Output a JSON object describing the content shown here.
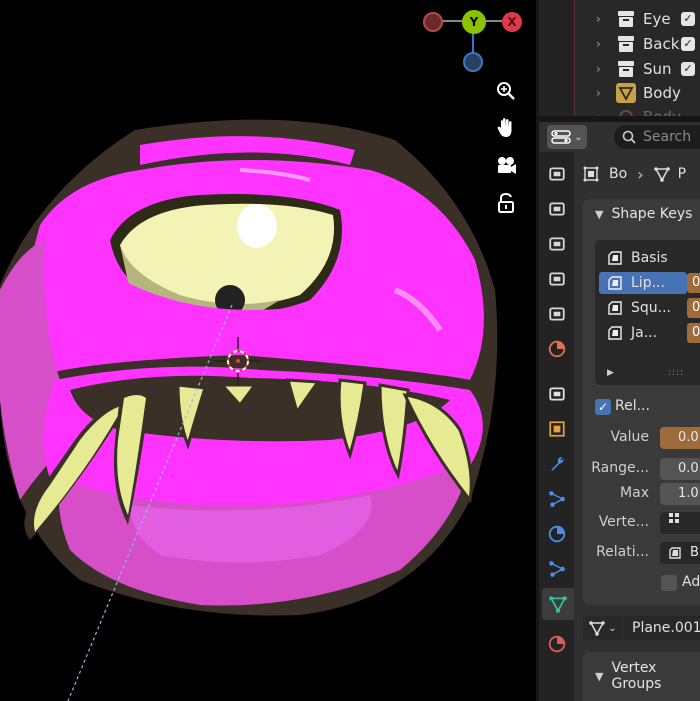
{
  "outliner": {
    "items": [
      {
        "label": "Eye",
        "checked": true,
        "icon": "collection-icon"
      },
      {
        "label": "Back",
        "checked": true,
        "icon": "collection-icon"
      },
      {
        "label": "Sun",
        "checked": true,
        "icon": "collection-icon"
      },
      {
        "label": "Body",
        "checked": false,
        "icon": "mesh-triangle-icon"
      },
      {
        "label": "Body",
        "checked": false,
        "icon": "object-icon"
      }
    ]
  },
  "gizmo": {
    "y_label": "Y",
    "x_label": "X",
    "colors": {
      "y": "#8cc300",
      "x": "#db3a49",
      "z": "#3a78c6"
    }
  },
  "viewport_tools": [
    "zoom-icon",
    "hand-pan-icon",
    "camera-icon",
    "lock-icon"
  ],
  "properties": {
    "search_placeholder": "Search",
    "breadcrumb": {
      "object": "Bo",
      "data": "P"
    },
    "shape_keys": {
      "title": "Shape Keys",
      "keys": [
        {
          "label": "Basis",
          "value": ""
        },
        {
          "label": "Lip...",
          "value": "0"
        },
        {
          "label": "Squ...",
          "value": "0"
        },
        {
          "label": "Ja...",
          "value": "0"
        }
      ],
      "selected_index": 1,
      "relative_label": "Rel...",
      "relative_checked": true,
      "value_label": "Value",
      "value": "0.0",
      "range_label": "Range...",
      "range_value": "0.0",
      "max_label": "Max",
      "max_value": "1.0",
      "vertex_label": "Verte...",
      "relative_to_label": "Relati...",
      "relative_to_value": "B",
      "add_label": "Add"
    },
    "mesh_name": "Plane.001",
    "vertex_groups_title": "Vertex Groups"
  },
  "colors": {
    "accent": "#4772b3",
    "magenta": "#ff33ff",
    "eye": "#f4f3b6",
    "outline": "#3a3027"
  }
}
